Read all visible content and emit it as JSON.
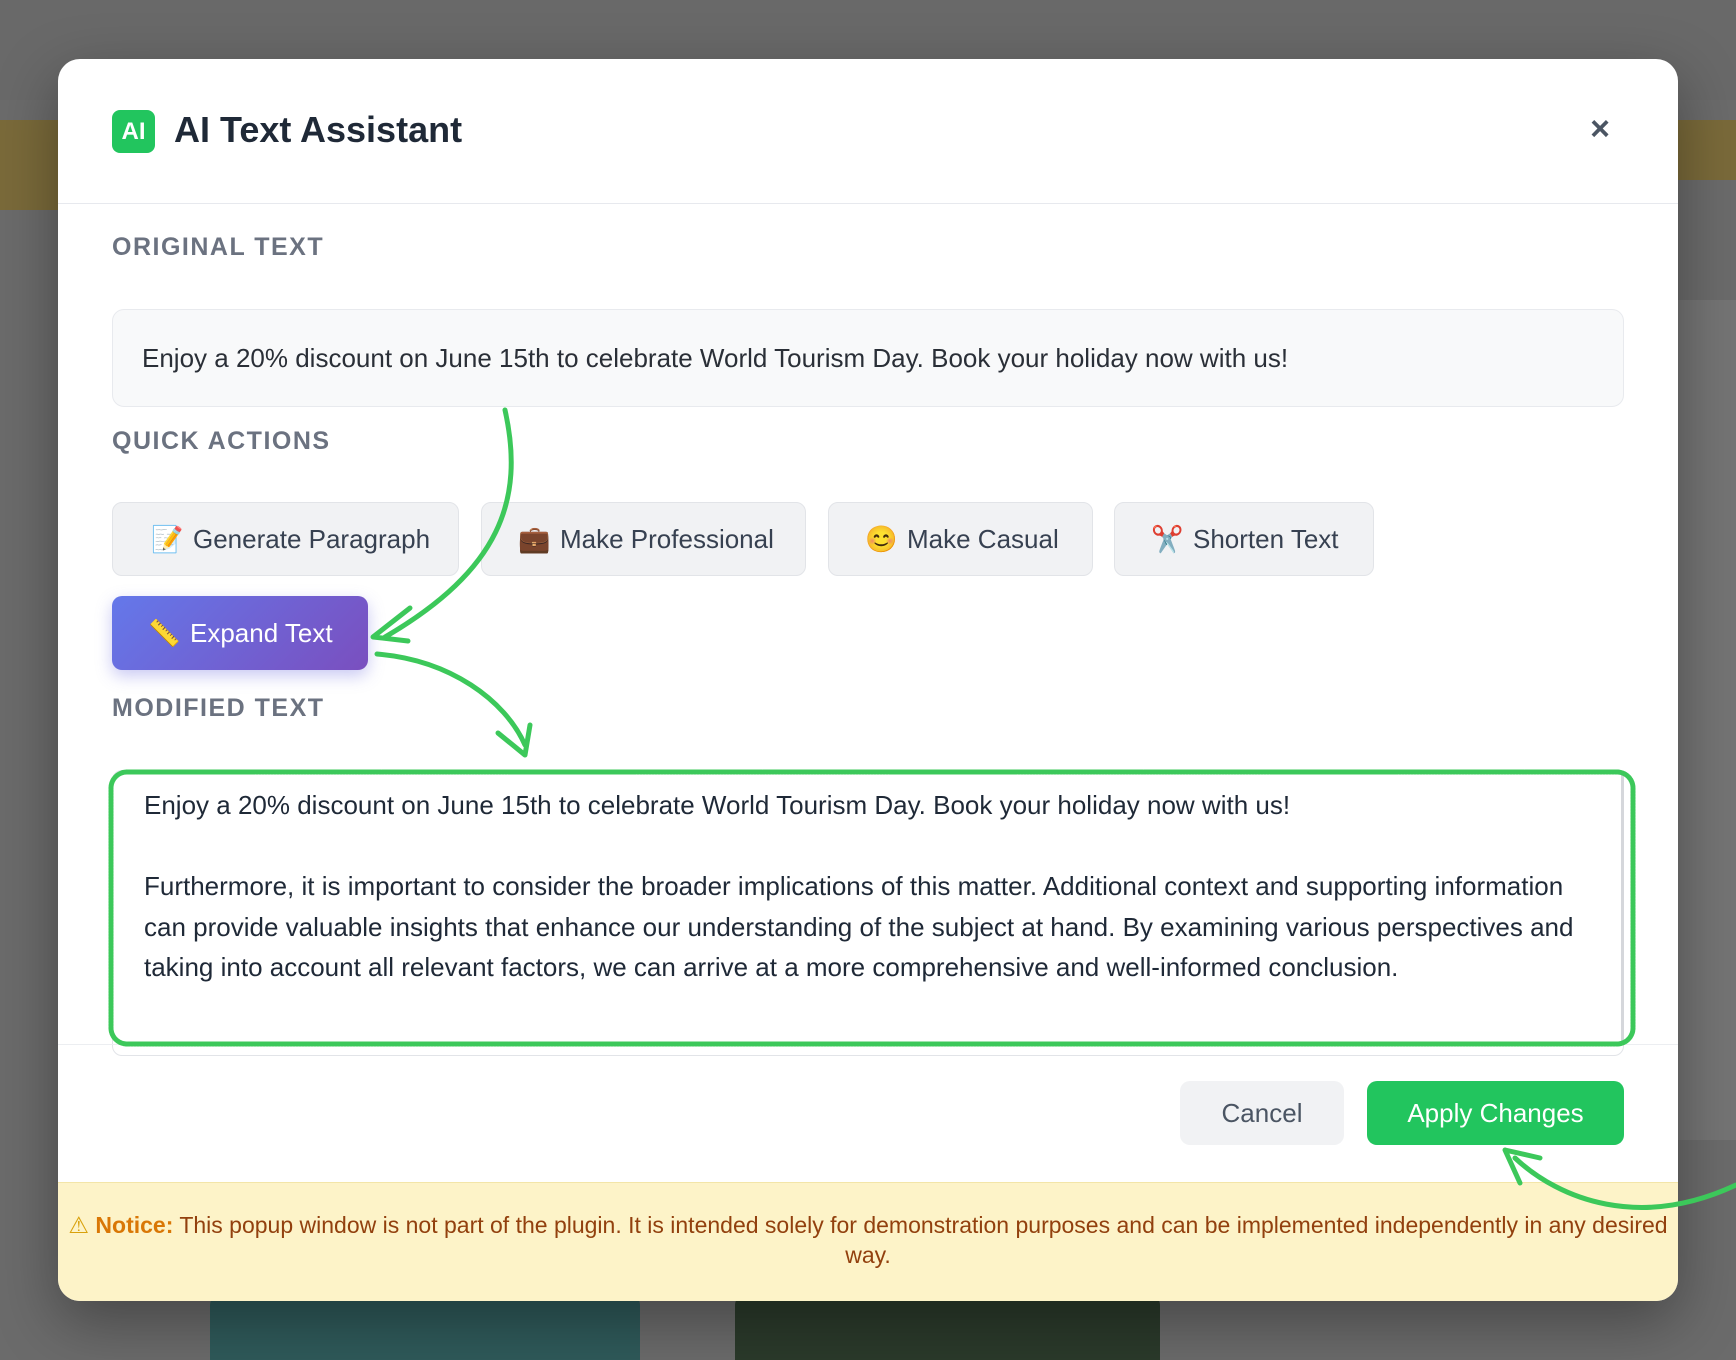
{
  "modal": {
    "badge": "AI",
    "title": "AI Text Assistant",
    "close_glyph": "×"
  },
  "original": {
    "label": "ORIGINAL TEXT",
    "text": "Enjoy a 20% discount on June 15th to celebrate World Tourism Day. Book your holiday now with us!"
  },
  "quick_actions": {
    "label": "QUICK ACTIONS",
    "buttons": [
      {
        "emoji": "📝",
        "label": "Generate Paragraph"
      },
      {
        "emoji": "💼",
        "label": "Make Professional"
      },
      {
        "emoji": "😊",
        "label": "Make Casual"
      },
      {
        "emoji": "✂️",
        "label": "Shorten Text"
      },
      {
        "emoji": "📏",
        "label": "Expand Text",
        "active": true
      }
    ]
  },
  "modified": {
    "label": "MODIFIED TEXT",
    "paragraphs": [
      "Enjoy a 20% discount on June 15th to celebrate World Tourism Day. Book your holiday now with us!",
      "Furthermore, it is important to consider the broader implications of this matter. Additional context and supporting information can provide valuable insights that enhance our understanding of the subject at hand. By examining various perspectives and taking into account all relevant factors, we can arrive at a more comprehensive and well-informed conclusion."
    ]
  },
  "footer": {
    "cancel_label": "Cancel",
    "apply_label": "Apply Changes"
  },
  "notice": {
    "icon": "⚠",
    "label": "Notice:",
    "text": "This popup window is not part of the plugin. It is intended solely for demonstration purposes and can be implemented independently in any desired way."
  },
  "colors": {
    "accent_green": "#22c55e",
    "active_gradient_start": "#6478ea",
    "active_gradient_end": "#7a4fbf",
    "annotation_green": "#3cc85a",
    "notice_bg": "#fdf3c8",
    "notice_text": "#92400e"
  }
}
